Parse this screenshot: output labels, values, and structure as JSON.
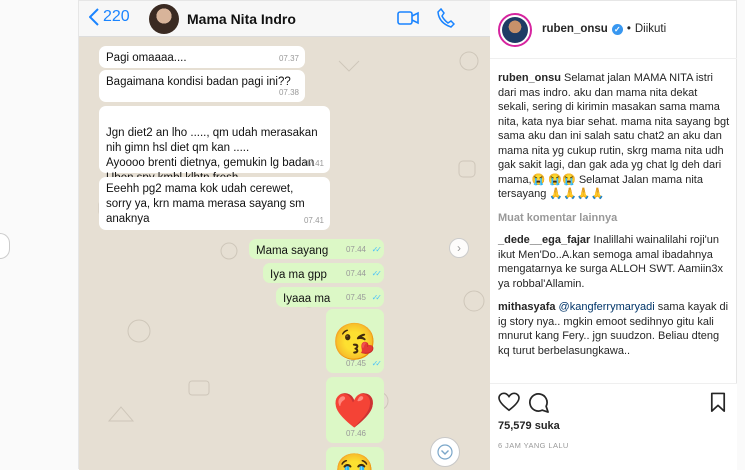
{
  "chat": {
    "back_count": "220",
    "contact_name": "Mama Nita Indro",
    "messages": [
      {
        "dir": "in",
        "text": "Pagi omaaaa....",
        "time": "07.37"
      },
      {
        "dir": "in",
        "text": "Bagaimana kondisi badan pagi ini??",
        "time": "07.38"
      },
      {
        "dir": "in",
        "text": "Jgn diet2 an lho .....,  qm udah merasakan nih gimn hsl diet qm kan .....\nAyoooo brenti dietnya,  gemukin lg badan Uben spy kmbl klhtn fresh ....",
        "time": "07.41"
      },
      {
        "dir": "in",
        "text": "Eeehh pg2 mama kok udah cerewet, sorry ya,  krn mama merasa sayang sm anaknya",
        "time": "07.41"
      },
      {
        "dir": "out",
        "text": "Mama sayang",
        "time": "07.44"
      },
      {
        "dir": "out",
        "text": "Iya ma gpp",
        "time": "07.44"
      },
      {
        "dir": "out",
        "text": "Iyaaa ma",
        "time": "07.45"
      },
      {
        "dir": "out",
        "emoji": "😘",
        "time": "07.45"
      },
      {
        "dir": "out",
        "emoji": "❤️",
        "time": "07.46"
      }
    ]
  },
  "post": {
    "username": "ruben_onsu",
    "follow_status": "Diikuti",
    "caption": "Selamat jalan MAMA NITA istri dari mas indro. aku dan mama nita dekat sekali, sering di kirimin masakan sama mama nita, kata nya biar sehat. mama nita sayang bgt sama aku dan ini salah satu chat2 an aku dan mama nita yg cukup rutin, skrg mama nita udh gak sakit lagi, dan gak ada yg chat lg deh dari mama,😭 😭😭 Selamat Jalan mama nita tersayang 🙏🙏🙏🙏",
    "more_comments": "Muat komentar lainnya",
    "comments": [
      {
        "user": "_dede__ega_fajar",
        "text": "Inalillahi wainalilahi roji'un ikut Men'Do..A.kan semoga amal ibadahnya mengatarnya ke surga ALLOH SWT. Aamiin3x ya robbal'Allamin."
      },
      {
        "user": "mithasyafa",
        "mention": "@kangferrymaryadi",
        "text": "sama kayak di ig story nya.. mgkin emoot sedihnyo gitu kali mnurut kang Fery.. jgn suudzon. Beliau dteng kq turut berbelasungkawa.."
      }
    ],
    "likes": "75,579 suka",
    "time_ago": "6 JAM YANG LALU"
  },
  "colors": {
    "chat_bg": "#e6dfd3",
    "incoming": "#ffffff",
    "outgoing": "#dcf8c6",
    "ios_blue": "#1a84ff",
    "ig_blue": "#3897f0"
  }
}
